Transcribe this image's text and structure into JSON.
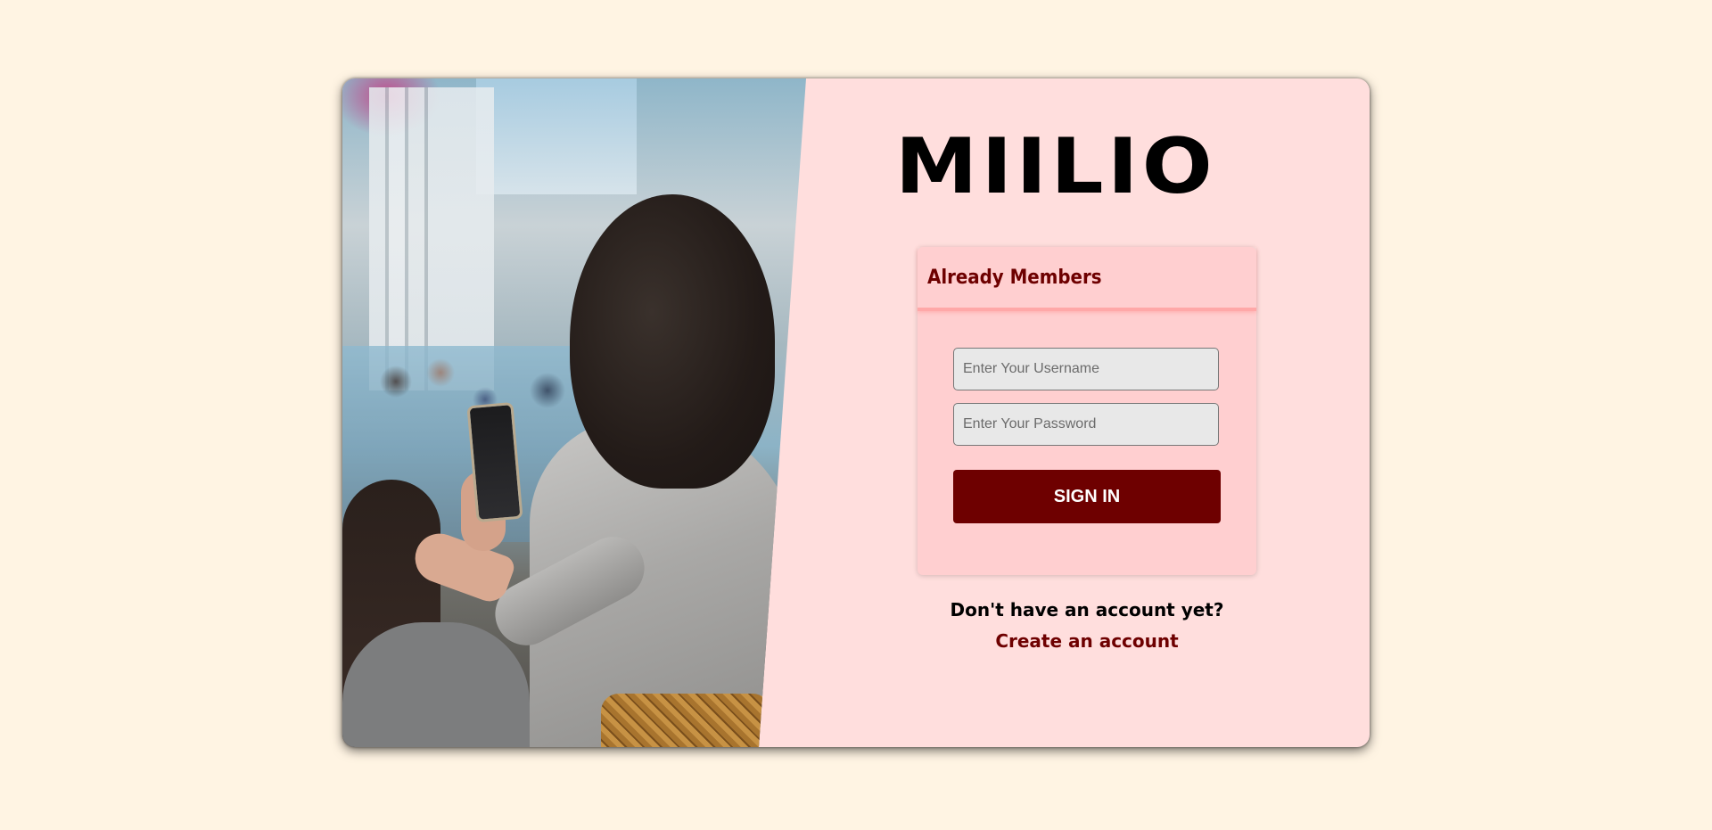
{
  "brand": {
    "logo_text": "MIILIO"
  },
  "login": {
    "title": "Already Members",
    "username_placeholder": "Enter Your Username",
    "password_placeholder": "Enter Your Password",
    "signin_label": "SIGN IN"
  },
  "signup": {
    "prompt": "Don't have an account yet?",
    "link_label": "Create an account"
  },
  "colors": {
    "page_background": "#fff4e3",
    "card_background": "#ffdedd",
    "login_box_background": "#ffcfd0",
    "accent": "#6e0000"
  }
}
